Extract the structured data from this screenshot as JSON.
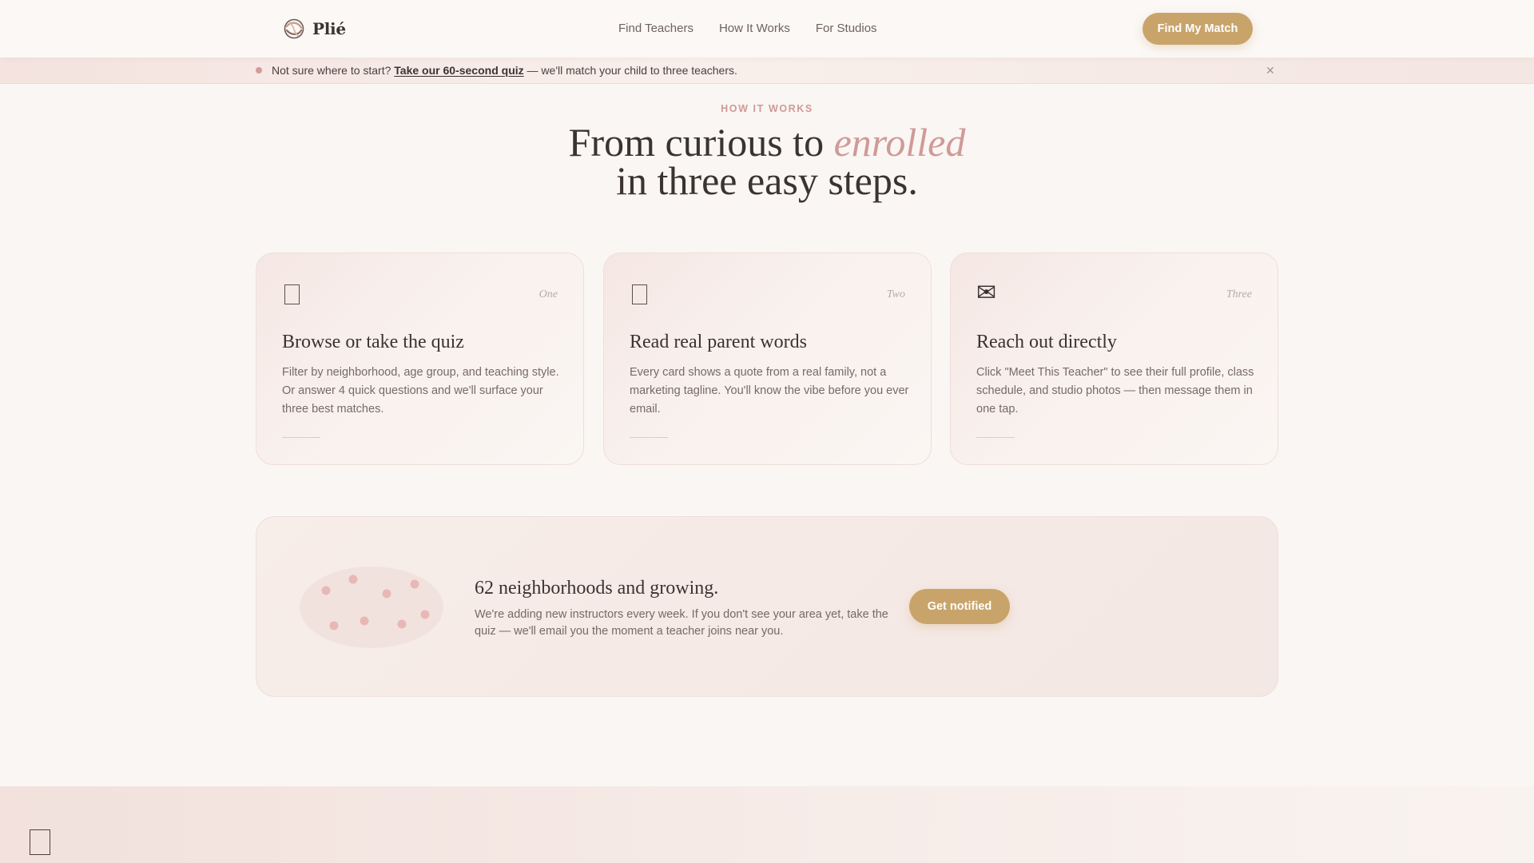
{
  "brand": {
    "name": "Plié",
    "logo_icon": "dance-ribbon-logo-icon",
    "accent_color": "#c9a46a",
    "rose_color": "#cf9a99"
  },
  "nav": {
    "items": [
      {
        "label": "Find Teachers"
      },
      {
        "label": "How It Works"
      },
      {
        "label": "For Studios"
      }
    ],
    "cta_label": "Find My Match"
  },
  "announcement": {
    "lead": "Not sure where to start? ",
    "link_label": "Take our 60-second quiz",
    "tail": " — we'll match your child to three teachers.",
    "close_icon": "close-icon"
  },
  "how_it_works": {
    "eyebrow": "HOW IT WORKS",
    "headline_start": "From curious to ",
    "headline_accent": "enrolled",
    "headline_end": "in three easy steps."
  },
  "steps": [
    {
      "icon": "search-card-icon",
      "number": "One",
      "title": "Browse or take the quiz",
      "body": "Filter by neighborhood, age group, and teaching style. Or answer 4 quick questions and we'll surface your three best matches."
    },
    {
      "icon": "quote-card-icon",
      "number": "Two",
      "title": "Read real parent words",
      "body": "Every card shows a quote from a real family, not a marketing tagline. You'll know the vibe before you ever email."
    },
    {
      "icon": "envelope-icon",
      "glyph": "✉",
      "number": "Three",
      "title": "Reach out directly",
      "body": "Click \"Meet This Teacher\" to see their full profile, class schedule, and studio photos — then message them in one tap."
    }
  ],
  "neighborhoods": {
    "map_icon": "neighborhood-map-icon",
    "title": "62 neighborhoods and growing.",
    "body": "We're adding new instructors every week. If you don't see your area yet, take the quiz — we'll email you the moment a teacher joins near you.",
    "button_label": "Get notified"
  },
  "footer": {
    "icon": "footer-card-icon"
  }
}
